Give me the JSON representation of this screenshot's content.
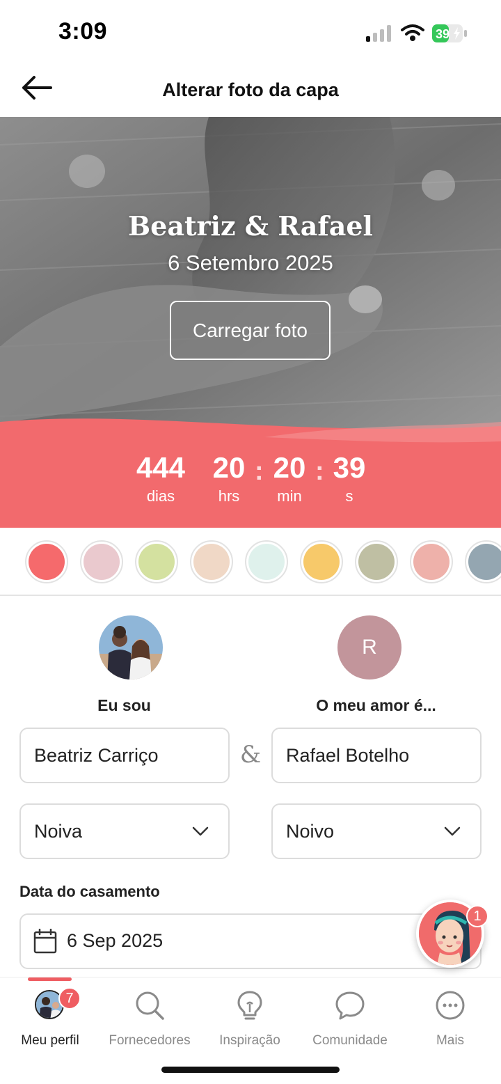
{
  "status_bar": {
    "time": "3:09",
    "battery": "39"
  },
  "header": {
    "title": "Alterar foto da capa"
  },
  "cover": {
    "couple_names": "Beatriz & Rafael",
    "wedding_date": "6 Setembro 2025",
    "upload_label": "Carregar foto"
  },
  "countdown": {
    "days": "444",
    "days_label": "dias",
    "hours": "20",
    "hours_label": "hrs",
    "minutes": "20",
    "minutes_label": "min",
    "seconds": "39",
    "seconds_label": "s",
    "separator": ":"
  },
  "colors": {
    "accent": "#f26a6d",
    "swatches": [
      "#f56a6c",
      "#eac9ce",
      "#d4e1a0",
      "#f0d8c6",
      "#dff1ec",
      "#f7c96a",
      "#bfbfa3",
      "#eeb1aa",
      "#94a6b1"
    ]
  },
  "partners": {
    "me_label": "Eu sou",
    "partner_label": "O meu amor é...",
    "partner_initial": "R",
    "me_name": "Beatriz Carriço",
    "partner_name": "Rafael Botelho",
    "ampersand": "&",
    "me_role": "Noiva",
    "partner_role": "Noivo"
  },
  "wedding": {
    "date_label": "Data do casamento",
    "date_value": "6 Sep 2025"
  },
  "helper": {
    "badge": "1"
  },
  "tabs": [
    {
      "label": "Meu perfil",
      "badge": "7"
    },
    {
      "label": "Fornecedores"
    },
    {
      "label": "Inspiração"
    },
    {
      "label": "Comunidade"
    },
    {
      "label": "Mais"
    }
  ]
}
